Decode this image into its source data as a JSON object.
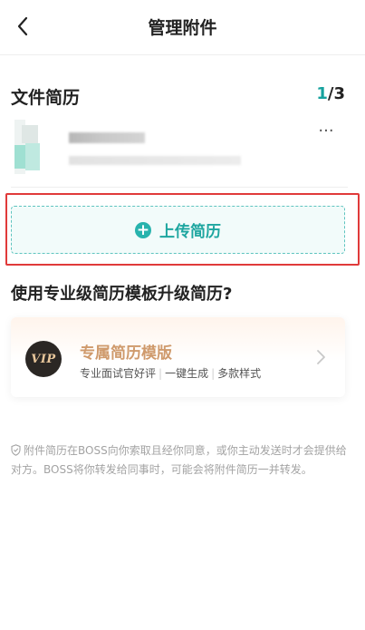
{
  "header": {
    "title": "管理附件"
  },
  "file_section": {
    "title": "文件简历",
    "count_current": "1",
    "count_total": "/3",
    "more_label": "···"
  },
  "upload": {
    "label": "上传简历"
  },
  "promo": {
    "title": "使用专业级简历模板升级简历?",
    "card": {
      "badge": "VIP",
      "name": "专属简历模版",
      "features": [
        "专业面试官好评",
        "一键生成",
        "多款样式"
      ]
    }
  },
  "notice": {
    "text": "附件简历在BOSS向你索取且经你同意，或你主动发送时才会提供给对方。BOSS将你转发给同事时，可能会将附件简历一并转发。"
  },
  "colors": {
    "accent": "#16a29e",
    "upload_border": "#5ec4bf",
    "highlight": "#e03a3a",
    "promo_gold": "#cf9a6c"
  },
  "icons": {
    "back": "chevron-left-icon",
    "plus": "plus-circle-icon",
    "chevron": "chevron-right-icon",
    "shield": "shield-icon"
  }
}
